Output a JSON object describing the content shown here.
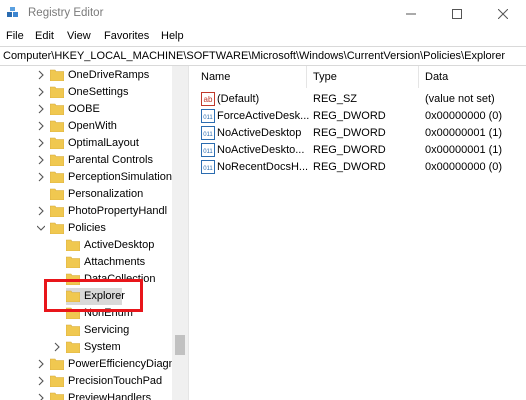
{
  "window": {
    "title": "Registry Editor"
  },
  "menu": {
    "file": "File",
    "edit": "Edit",
    "view": "View",
    "favorites": "Favorites",
    "help": "Help"
  },
  "address": {
    "path": "Computer\\HKEY_LOCAL_MACHINE\\SOFTWARE\\Microsoft\\Windows\\CurrentVersion\\Policies\\Explorer"
  },
  "tree": {
    "items": [
      {
        "label": "OneDriveRamps",
        "expandable": true,
        "selected": false
      },
      {
        "label": "OneSettings",
        "expandable": true,
        "selected": false
      },
      {
        "label": "OOBE",
        "expandable": true,
        "selected": false
      },
      {
        "label": "OpenWith",
        "expandable": true,
        "selected": false
      },
      {
        "label": "OptimalLayout",
        "expandable": true,
        "selected": false
      },
      {
        "label": "Parental Controls",
        "expandable": true,
        "selected": false
      },
      {
        "label": "PerceptionSimulation",
        "expandable": true,
        "selected": false
      },
      {
        "label": "Personalization",
        "expandable": false,
        "selected": false
      },
      {
        "label": "PhotoPropertyHandl",
        "expandable": true,
        "selected": false
      },
      {
        "label": "Policies",
        "expandable": true,
        "expanded": true,
        "selected": false
      },
      {
        "label": "ActiveDesktop",
        "expandable": false,
        "selected": false
      },
      {
        "label": "Attachments",
        "expandable": false,
        "selected": false
      },
      {
        "label": "DataCollection",
        "expandable": false,
        "selected": false
      },
      {
        "label": "Explorer",
        "expandable": false,
        "selected": true
      },
      {
        "label": "NonEnum",
        "expandable": false,
        "selected": false
      },
      {
        "label": "Servicing",
        "expandable": false,
        "selected": false
      },
      {
        "label": "System",
        "expandable": true,
        "selected": false
      },
      {
        "label": "PowerEfficiencyDiagn",
        "expandable": true,
        "selected": false
      },
      {
        "label": "PrecisionTouchPad",
        "expandable": true,
        "selected": false
      },
      {
        "label": "PreviewHandlers",
        "expandable": true,
        "selected": false
      }
    ]
  },
  "values": {
    "columns": {
      "name": "Name",
      "type": "Type",
      "data": "Data"
    },
    "rows": [
      {
        "name": "(Default)",
        "type": "REG_SZ",
        "data": "(value not set)",
        "icon": "string-value-icon"
      },
      {
        "name": "ForceActiveDesk...",
        "type": "REG_DWORD",
        "data": "0x00000000 (0)",
        "icon": "binary-value-icon"
      },
      {
        "name": "NoActiveDesktop",
        "type": "REG_DWORD",
        "data": "0x00000001 (1)",
        "icon": "binary-value-icon"
      },
      {
        "name": "NoActiveDeskto...",
        "type": "REG_DWORD",
        "data": "0x00000001 (1)",
        "icon": "binary-value-icon"
      },
      {
        "name": "NoRecentDocsH...",
        "type": "REG_DWORD",
        "data": "0x00000000 (0)",
        "icon": "binary-value-icon"
      }
    ]
  },
  "colors": {
    "highlight": "#e8151a",
    "folder": "#f0c850",
    "selection": "#d9d9d9"
  }
}
